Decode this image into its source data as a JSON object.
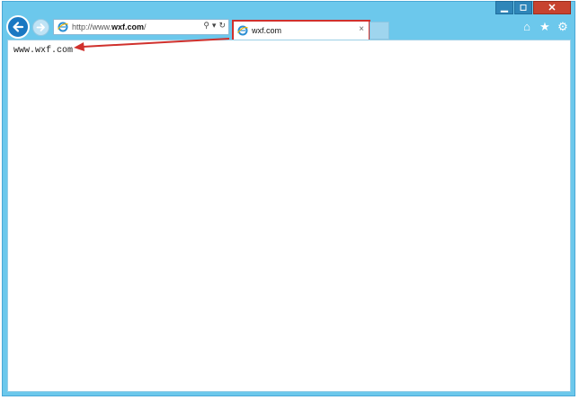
{
  "window": {
    "controls": {
      "minimize": "▁",
      "maximize": "◻",
      "close": "✕"
    }
  },
  "nav": {
    "back_icon": "back-arrow-icon",
    "forward_icon": "forward-arrow-icon"
  },
  "addressbar": {
    "url_prefix": "http://www.",
    "url_domain": "wxf.com",
    "url_suffix": "/",
    "search_icon": "⚲",
    "dropdown_icon": "▾",
    "refresh_icon": "↻"
  },
  "tab": {
    "title": "wxf.com",
    "close": "×"
  },
  "toolbar": {
    "home_icon": "⌂",
    "favorites_icon": "★",
    "settings_icon": "⚙"
  },
  "content": {
    "text": "www.wxf.com"
  },
  "colors": {
    "frame": "#6cc8ec",
    "back_button": "#1a78c2",
    "highlight": "#d0312d",
    "close_button": "#c7432f"
  }
}
